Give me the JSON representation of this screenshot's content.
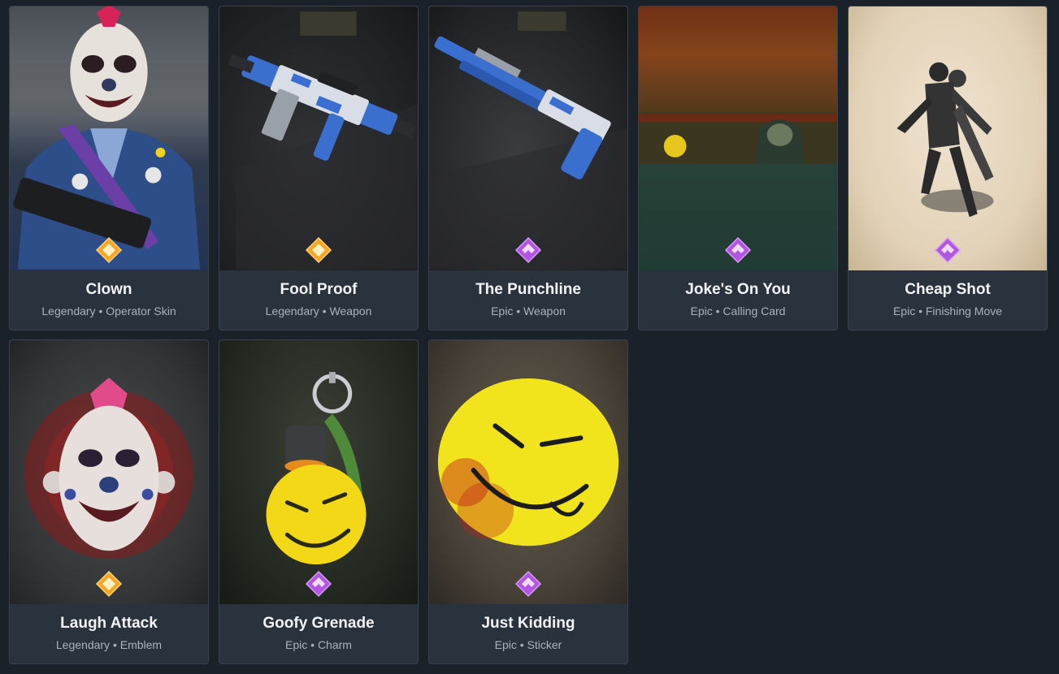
{
  "items": [
    {
      "name": "Clown",
      "rarity": "Legendary",
      "type": "Operator Skin",
      "subtitle": "Legendary • Operator Skin",
      "rarity_color": "#f5a623"
    },
    {
      "name": "Fool Proof",
      "rarity": "Legendary",
      "type": "Weapon",
      "subtitle": "Legendary • Weapon",
      "rarity_color": "#f5a623"
    },
    {
      "name": "The Punchline",
      "rarity": "Epic",
      "type": "Weapon",
      "subtitle": "Epic • Weapon",
      "rarity_color": "#b056e0"
    },
    {
      "name": "Joke's On You",
      "rarity": "Epic",
      "type": "Calling Card",
      "subtitle": "Epic • Calling Card",
      "rarity_color": "#b056e0"
    },
    {
      "name": "Cheap Shot",
      "rarity": "Epic",
      "type": "Finishing Move",
      "subtitle": "Epic • Finishing Move",
      "rarity_color": "#b056e0"
    },
    {
      "name": "Laugh Attack",
      "rarity": "Legendary",
      "type": "Emblem",
      "subtitle": "Legendary • Emblem",
      "rarity_color": "#f5a623"
    },
    {
      "name": "Goofy Grenade",
      "rarity": "Epic",
      "type": "Charm",
      "subtitle": "Epic • Charm",
      "rarity_color": "#b056e0"
    },
    {
      "name": "Just Kidding",
      "rarity": "Epic",
      "type": "Sticker",
      "subtitle": "Epic • Sticker",
      "rarity_color": "#b056e0"
    }
  ],
  "colors": {
    "background": "#1a2129",
    "card": "#2a323d",
    "legendary": "#f5a623",
    "epic": "#b056e0"
  }
}
